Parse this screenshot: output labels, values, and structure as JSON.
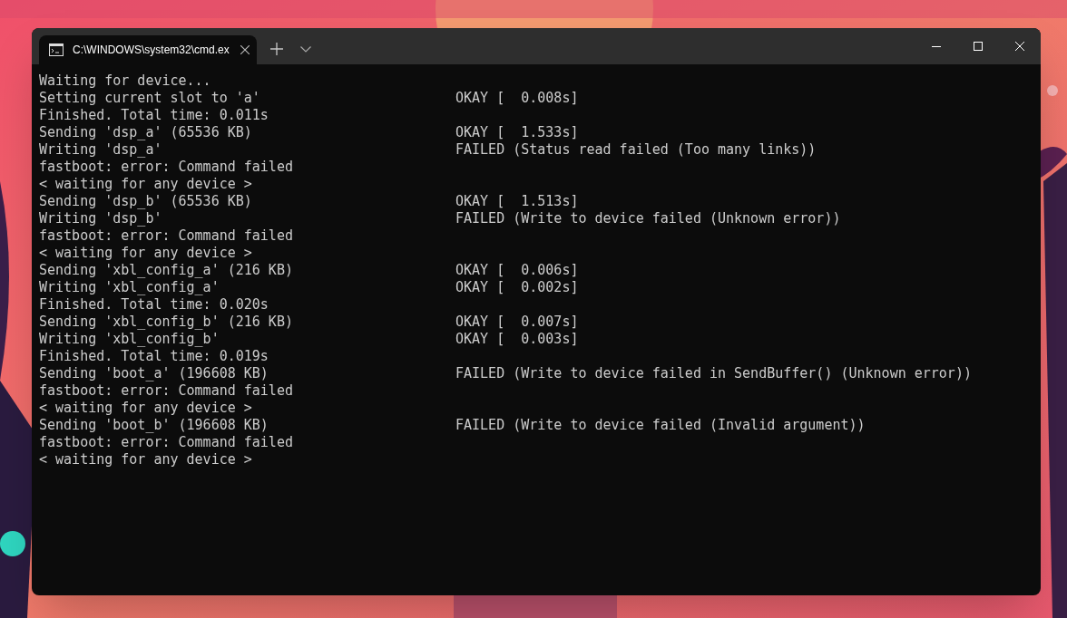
{
  "window": {
    "tabs": [
      {
        "title": "C:\\WINDOWS\\system32\\cmd.ex",
        "selected": true
      }
    ]
  },
  "terminal": {
    "lines": [
      {
        "text": "Waiting for device..."
      },
      {
        "text": "Setting current slot to 'a'",
        "result": "OKAY [  0.008s]"
      },
      {
        "text": "Finished. Total time: 0.011s"
      },
      {
        "text": "Sending 'dsp_a' (65536 KB)",
        "result": "OKAY [  1.533s]"
      },
      {
        "text": "Writing 'dsp_a'",
        "result": "FAILED (Status read failed (Too many links))"
      },
      {
        "text": "fastboot: error: Command failed"
      },
      {
        "text": "< waiting for any device >"
      },
      {
        "text": "Sending 'dsp_b' (65536 KB)",
        "result": "OKAY [  1.513s]"
      },
      {
        "text": "Writing 'dsp_b'",
        "result": "FAILED (Write to device failed (Unknown error))"
      },
      {
        "text": "fastboot: error: Command failed"
      },
      {
        "text": "< waiting for any device >"
      },
      {
        "text": "Sending 'xbl_config_a' (216 KB)",
        "result": "OKAY [  0.006s]"
      },
      {
        "text": "Writing 'xbl_config_a'",
        "result": "OKAY [  0.002s]"
      },
      {
        "text": "Finished. Total time: 0.020s"
      },
      {
        "text": "Sending 'xbl_config_b' (216 KB)",
        "result": "OKAY [  0.007s]"
      },
      {
        "text": "Writing 'xbl_config_b'",
        "result": "OKAY [  0.003s]"
      },
      {
        "text": "Finished. Total time: 0.019s"
      },
      {
        "text": "Sending 'boot_a' (196608 KB)",
        "result": "FAILED (Write to device failed in SendBuffer() (Unknown error))"
      },
      {
        "text": "fastboot: error: Command failed"
      },
      {
        "text": "< waiting for any device >"
      },
      {
        "text": "Sending 'boot_b' (196608 KB)",
        "result": "FAILED (Write to device failed (Invalid argument))"
      },
      {
        "text": "fastboot: error: Command failed"
      },
      {
        "text": "< waiting for any device >"
      }
    ]
  }
}
